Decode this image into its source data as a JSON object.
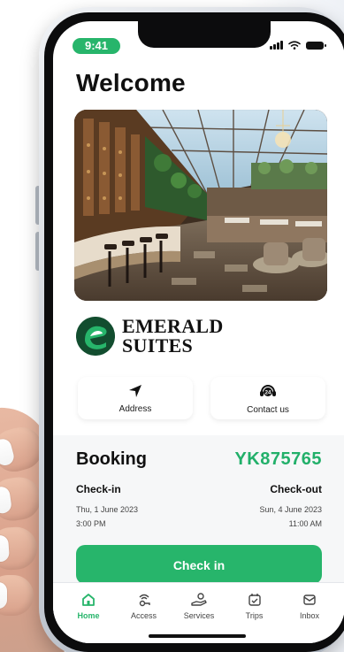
{
  "status": {
    "time": "9:41"
  },
  "page": {
    "title": "Welcome"
  },
  "brand": {
    "name_line1": "EMERALD",
    "name_line2": "SUITES",
    "accent": "#27b56b",
    "dark_green": "#124d2f"
  },
  "actions": [
    {
      "label": "Address",
      "icon": "navigation-arrow-icon"
    },
    {
      "label": "Contact us",
      "icon": "24h-support-icon"
    }
  ],
  "booking": {
    "title": "Booking",
    "code": "YK875765",
    "checkin": {
      "label": "Check-in",
      "date": "Thu, 1 June 2023",
      "time": "3:00 PM"
    },
    "checkout": {
      "label": "Check-out",
      "date": "Sun, 4 June 2023",
      "time": "11:00 AM"
    },
    "button": "Check in"
  },
  "tabs": [
    {
      "label": "Home",
      "icon": "home-icon",
      "active": true
    },
    {
      "label": "Access",
      "icon": "access-key-icon",
      "active": false
    },
    {
      "label": "Services",
      "icon": "services-icon",
      "active": false
    },
    {
      "label": "Trips",
      "icon": "calendar-check-icon",
      "active": false
    },
    {
      "label": "Inbox",
      "icon": "inbox-icon",
      "active": false
    }
  ]
}
